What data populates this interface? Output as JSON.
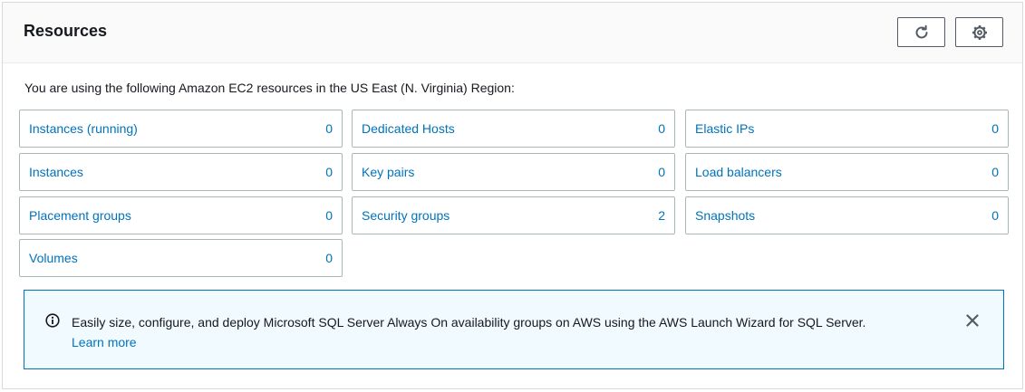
{
  "panel": {
    "title": "Resources",
    "refresh_icon": "refresh-icon",
    "settings_icon": "gear-icon"
  },
  "intro": "You are using the following Amazon EC2 resources in the US East (N. Virginia) Region:",
  "resources": [
    {
      "label": "Instances (running)",
      "count": "0"
    },
    {
      "label": "Dedicated Hosts",
      "count": "0"
    },
    {
      "label": "Elastic IPs",
      "count": "0"
    },
    {
      "label": "Instances",
      "count": "0"
    },
    {
      "label": "Key pairs",
      "count": "0"
    },
    {
      "label": "Load balancers",
      "count": "0"
    },
    {
      "label": "Placement groups",
      "count": "0"
    },
    {
      "label": "Security groups",
      "count": "2"
    },
    {
      "label": "Snapshots",
      "count": "0"
    },
    {
      "label": "Volumes",
      "count": "0"
    }
  ],
  "flash": {
    "icon": "info-icon",
    "message": "Easily size, configure, and deploy Microsoft SQL Server Always On availability groups on AWS using the AWS Launch Wizard for SQL Server.",
    "link": "Learn more",
    "close_icon": "close-icon"
  },
  "colors": {
    "link": "#0073bb",
    "info_background": "#f1faff",
    "border": "#aab7b8"
  }
}
